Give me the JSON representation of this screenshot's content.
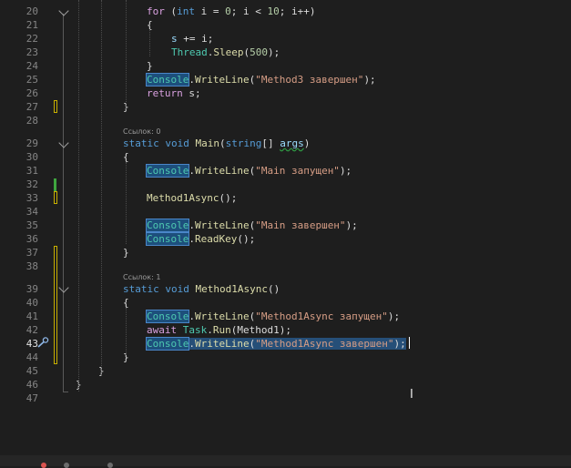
{
  "lines": [
    {
      "n": "20",
      "tokens": [
        {
          "t": "for",
          "c": "kwc"
        },
        {
          "t": " (",
          "c": "pl"
        },
        {
          "t": "int",
          "c": "kw"
        },
        {
          "t": " i = ",
          "c": "pl"
        },
        {
          "t": "0",
          "c": "num"
        },
        {
          "t": "; i < ",
          "c": "pl"
        },
        {
          "t": "10",
          "c": "num"
        },
        {
          "t": "; i++)",
          "c": "pl"
        }
      ]
    },
    {
      "n": "21",
      "tokens": [
        {
          "t": "{",
          "c": "pl"
        }
      ]
    },
    {
      "n": "22",
      "tokens": [
        {
          "t": "s",
          "c": "var"
        },
        {
          "t": " += i;",
          "c": "pl"
        }
      ]
    },
    {
      "n": "23",
      "tokens": [
        {
          "t": "Thread",
          "c": "ty"
        },
        {
          "t": ".",
          "c": "pl"
        },
        {
          "t": "Sleep",
          "c": "fn"
        },
        {
          "t": "(",
          "c": "pl"
        },
        {
          "t": "500",
          "c": "num"
        },
        {
          "t": ");",
          "c": "pl"
        }
      ]
    },
    {
      "n": "24",
      "tokens": [
        {
          "t": "}",
          "c": "pl"
        }
      ]
    },
    {
      "n": "25",
      "tokens": [
        {
          "t": "Console",
          "c": "ty hl"
        },
        {
          "t": ".",
          "c": "pl"
        },
        {
          "t": "WriteLine",
          "c": "fn"
        },
        {
          "t": "(",
          "c": "pl"
        },
        {
          "t": "\"Method3 завершен\"",
          "c": "str"
        },
        {
          "t": ");",
          "c": "pl"
        }
      ]
    },
    {
      "n": "26",
      "tokens": [
        {
          "t": "return",
          "c": "kwc"
        },
        {
          "t": " s;",
          "c": "pl"
        }
      ]
    },
    {
      "n": "27",
      "tokens": [
        {
          "t": "}",
          "c": "pl"
        }
      ]
    },
    {
      "n": "28",
      "tokens": []
    },
    {
      "n": "29",
      "tokens": [
        {
          "t": "static",
          "c": "kw"
        },
        {
          "t": " ",
          "c": "pl"
        },
        {
          "t": "void",
          "c": "kw"
        },
        {
          "t": " ",
          "c": "pl"
        },
        {
          "t": "Main",
          "c": "fn"
        },
        {
          "t": "(",
          "c": "pl"
        },
        {
          "t": "string",
          "c": "kw"
        },
        {
          "t": "[] ",
          "c": "pl"
        },
        {
          "t": "args",
          "c": "var squig"
        },
        {
          "t": ")",
          "c": "pl"
        }
      ]
    },
    {
      "n": "30",
      "tokens": [
        {
          "t": "{",
          "c": "pl"
        }
      ]
    },
    {
      "n": "31",
      "tokens": [
        {
          "t": "Console",
          "c": "ty hl"
        },
        {
          "t": ".",
          "c": "pl"
        },
        {
          "t": "WriteLine",
          "c": "fn"
        },
        {
          "t": "(",
          "c": "pl"
        },
        {
          "t": "\"Main запущен\"",
          "c": "str"
        },
        {
          "t": ");",
          "c": "pl"
        }
      ]
    },
    {
      "n": "32",
      "tokens": []
    },
    {
      "n": "33",
      "tokens": [
        {
          "t": "Method1Async",
          "c": "fn"
        },
        {
          "t": "();",
          "c": "pl"
        }
      ]
    },
    {
      "n": "34",
      "tokens": []
    },
    {
      "n": "35",
      "tokens": [
        {
          "t": "Console",
          "c": "ty hl"
        },
        {
          "t": ".",
          "c": "pl"
        },
        {
          "t": "WriteLine",
          "c": "fn"
        },
        {
          "t": "(",
          "c": "pl"
        },
        {
          "t": "\"Main завершен\"",
          "c": "str"
        },
        {
          "t": ");",
          "c": "pl"
        }
      ]
    },
    {
      "n": "36",
      "tokens": [
        {
          "t": "Console",
          "c": "ty hl"
        },
        {
          "t": ".",
          "c": "pl"
        },
        {
          "t": "ReadKey",
          "c": "fn"
        },
        {
          "t": "();",
          "c": "pl"
        }
      ]
    },
    {
      "n": "37",
      "tokens": [
        {
          "t": "}",
          "c": "pl"
        }
      ]
    },
    {
      "n": "38",
      "tokens": []
    },
    {
      "n": "39",
      "tokens": [
        {
          "t": "static",
          "c": "kw"
        },
        {
          "t": " ",
          "c": "pl"
        },
        {
          "t": "void",
          "c": "kw"
        },
        {
          "t": " ",
          "c": "pl"
        },
        {
          "t": "Method1Async",
          "c": "fn"
        },
        {
          "t": "()",
          "c": "pl"
        }
      ]
    },
    {
      "n": "40",
      "tokens": [
        {
          "t": "{",
          "c": "pl"
        }
      ]
    },
    {
      "n": "41",
      "tokens": [
        {
          "t": "Console",
          "c": "ty hl"
        },
        {
          "t": ".",
          "c": "pl"
        },
        {
          "t": "WriteLine",
          "c": "fn"
        },
        {
          "t": "(",
          "c": "pl"
        },
        {
          "t": "\"Method1Async запущен\"",
          "c": "str"
        },
        {
          "t": ");",
          "c": "pl"
        }
      ]
    },
    {
      "n": "42",
      "tokens": [
        {
          "t": "await",
          "c": "kwc"
        },
        {
          "t": " ",
          "c": "pl"
        },
        {
          "t": "Task",
          "c": "ty"
        },
        {
          "t": ".",
          "c": "pl"
        },
        {
          "t": "Run",
          "c": "fn"
        },
        {
          "t": "(Method1);",
          "c": "pl"
        }
      ]
    },
    {
      "n": "43",
      "tokens": [
        {
          "t": "Console",
          "c": "ty hl"
        },
        {
          "t": ".",
          "c": "pl sel"
        },
        {
          "t": "WriteLine",
          "c": "fn sel"
        },
        {
          "t": "(",
          "c": "pl sel"
        },
        {
          "t": "\"Method1Async завершен\"",
          "c": "str sel"
        },
        {
          "t": ");",
          "c": "pl sel"
        }
      ]
    },
    {
      "n": "44",
      "tokens": [
        {
          "t": "}",
          "c": "pl"
        }
      ]
    },
    {
      "n": "45",
      "tokens": [
        {
          "t": "}",
          "c": "pl"
        }
      ]
    },
    {
      "n": "46",
      "tokens": [
        {
          "t": "}",
          "c": "pl"
        }
      ]
    },
    {
      "n": "47",
      "tokens": []
    }
  ],
  "codelens": [
    {
      "before_line": "29",
      "text": "Ссылок: 0"
    },
    {
      "before_line": "39",
      "text": "Ссылок: 1"
    }
  ],
  "current_line": "43",
  "colors": {
    "background": "#1e1e1e",
    "keyword": "#569cd6",
    "control": "#d8a0df",
    "type": "#4ec9b0",
    "method": "#dcdcaa",
    "string": "#d69d85",
    "number": "#b5cea8"
  },
  "icons": [
    "quick-actions-icon",
    "collapse-chevron-icon",
    "text-cursor-icon"
  ]
}
